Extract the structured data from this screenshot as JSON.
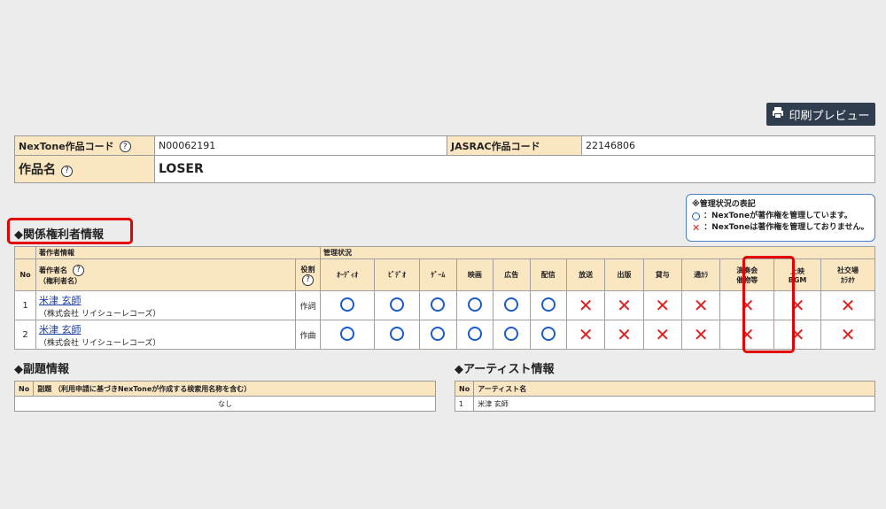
{
  "print_button": {
    "label": "印刷プレビュー",
    "icon": "printer-icon"
  },
  "work_info": {
    "nextone_code_label": "NexTone作品コード",
    "nextone_code": "N00062191",
    "jasrac_code_label": "JASRAC作品コード",
    "jasrac_code": "22146806",
    "title_label": "作品名",
    "title": "LOSER"
  },
  "legend": {
    "title": "※管理状況の表記",
    "managed": "：NexToneが著作権を管理しています。",
    "not_managed": "：NexToneは著作権を管理しておりません。"
  },
  "rights_section": {
    "title": "◆関係権利者情報",
    "group_author": "著作者情報",
    "group_status": "管理状況",
    "col_no": "No",
    "col_author_line1": "著作者名",
    "col_author_line2": "（権利者名）",
    "col_role": "役割",
    "columns": [
      {
        "l1": "ｵｰﾃﾞｨｵ",
        "l2": ""
      },
      {
        "l1": "ﾋﾞﾃﾞｵ",
        "l2": ""
      },
      {
        "l1": "ｹﾞｰﾑ",
        "l2": ""
      },
      {
        "l1": "映画",
        "l2": ""
      },
      {
        "l1": "広告",
        "l2": ""
      },
      {
        "l1": "配信",
        "l2": ""
      },
      {
        "l1": "放送",
        "l2": ""
      },
      {
        "l1": "出版",
        "l2": ""
      },
      {
        "l1": "貸与",
        "l2": ""
      },
      {
        "l1": "通ｶﾗ",
        "l2": ""
      },
      {
        "l1": "演奏会",
        "l2": "催物等"
      },
      {
        "l1": "上映",
        "l2": "BGM"
      },
      {
        "l1": "社交場",
        "l2": "ｶﾗｵｹ"
      }
    ],
    "rows": [
      {
        "no": "1",
        "name": "米津 玄師",
        "company": "（株式会社 リイシューレコーズ）",
        "role": "作詞",
        "status": [
          "o",
          "o",
          "o",
          "o",
          "o",
          "o",
          "x",
          "x",
          "x",
          "x",
          "x",
          "x",
          "x"
        ]
      },
      {
        "no": "2",
        "name": "米津 玄師",
        "company": "（株式会社 リイシューレコーズ）",
        "role": "作曲",
        "status": [
          "o",
          "o",
          "o",
          "o",
          "o",
          "o",
          "x",
          "x",
          "x",
          "x",
          "x",
          "x",
          "x"
        ]
      }
    ]
  },
  "subtitle_section": {
    "title": "◆副題情報",
    "col_no": "No",
    "col_name": "副題 （利用申請に基づきNexToneが作成する検索用名称を含む）",
    "empty_value": "なし"
  },
  "artist_section": {
    "title": "◆アーティスト情報",
    "col_no": "No",
    "col_name": "アーティスト名",
    "rows": [
      {
        "no": "1",
        "name": "米津 玄師"
      }
    ]
  },
  "colors": {
    "header_bg": "#fbe6c2",
    "circle": "#1a5dc8",
    "cross": "#e02020",
    "highlight": "#e30000",
    "button": "#2f3d4f"
  }
}
